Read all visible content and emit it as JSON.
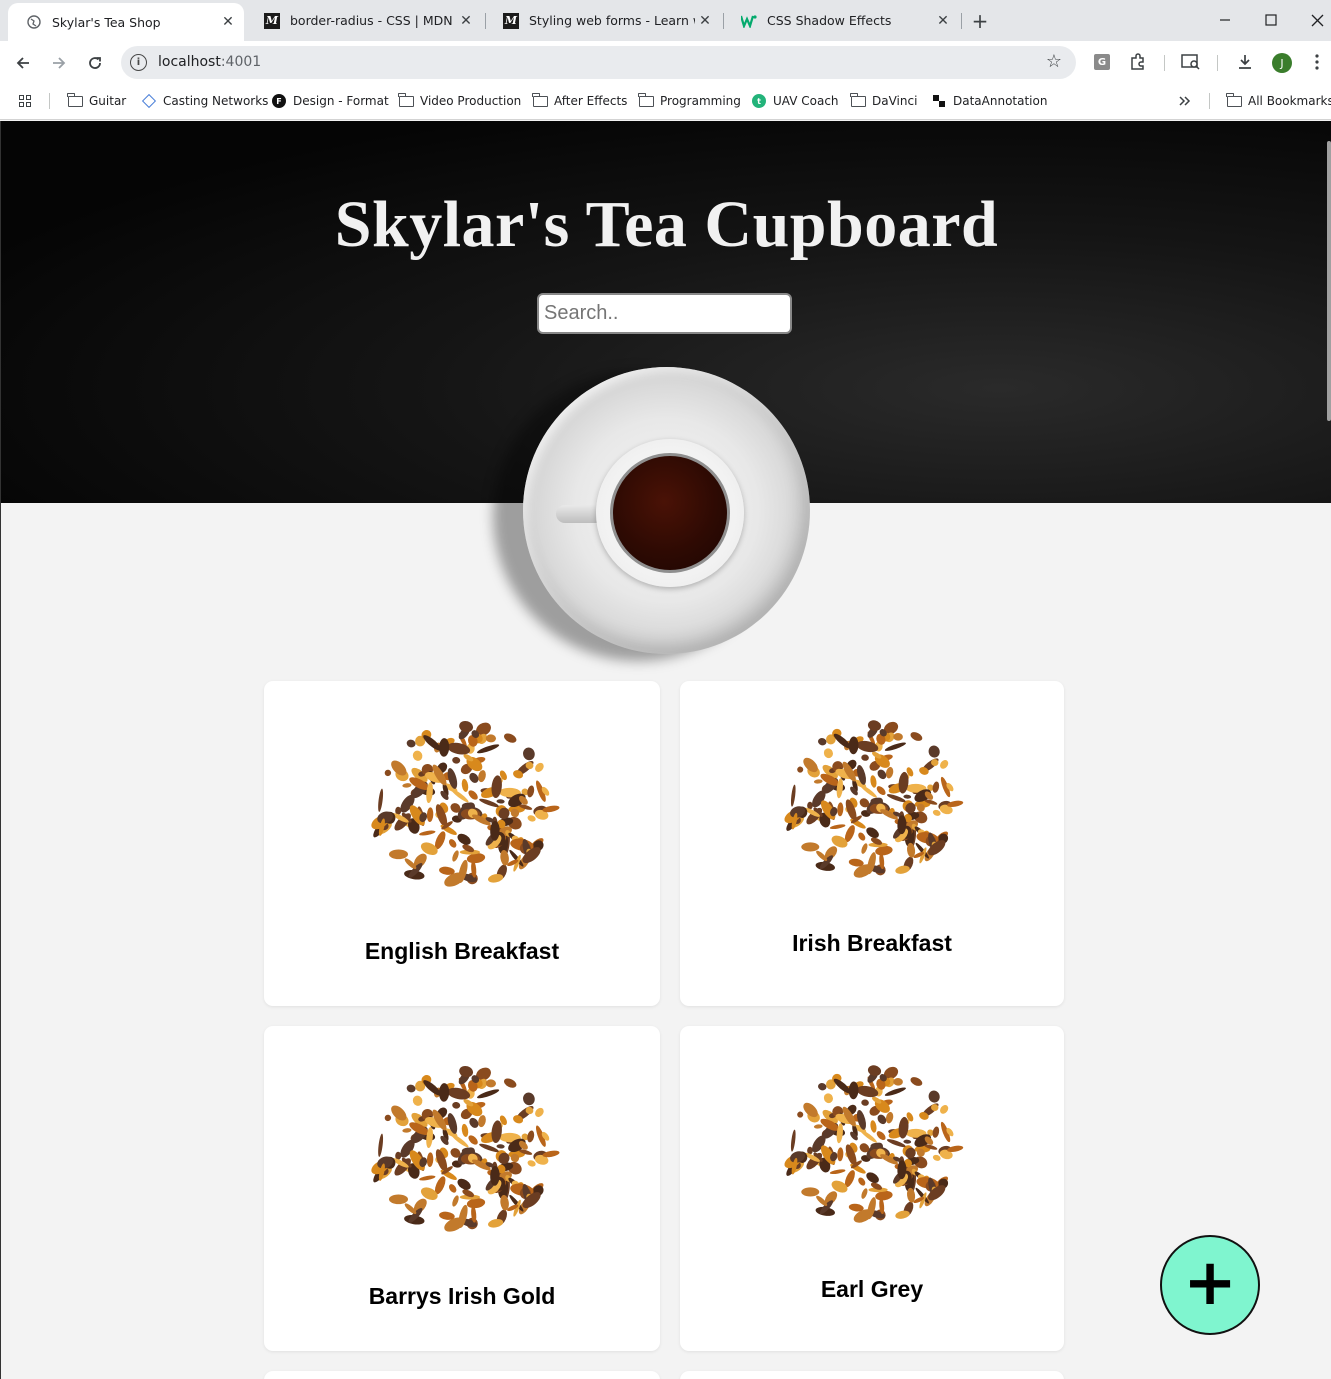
{
  "browser": {
    "tabs": [
      {
        "title": "Skylar's Tea Shop",
        "active": true
      },
      {
        "title": "border-radius - CSS | MDN",
        "active": false
      },
      {
        "title": "Styling web forms - Learn web d",
        "active": false
      },
      {
        "title": "CSS Shadow Effects",
        "active": false
      }
    ],
    "url_host": "localhost",
    "url_port": ":4001",
    "avatar_initial": "J",
    "extension_letter": "G",
    "bookmarks": [
      "Guitar",
      "Casting Networks",
      "Design - Format",
      "Video Production",
      "After Effects",
      "Programming",
      "UAV Coach",
      "DaVinci",
      "DataAnnotation"
    ],
    "all_bookmarks": "All Bookmarks",
    "icons": {
      "design_badge": "F",
      "uav_badge": "t"
    }
  },
  "page": {
    "title": "Skylar's Tea Cupboard",
    "search_placeholder": "Search..",
    "teas": [
      {
        "name": "English Breakfast"
      },
      {
        "name": "Irish Breakfast"
      },
      {
        "name": "Barrys Irish Gold"
      },
      {
        "name": "Earl Grey"
      }
    ],
    "add_button": "+"
  },
  "colors": {
    "fab": "#7ff5cf",
    "page_bg": "#f3f3f3",
    "hero_bg": "#000000"
  }
}
